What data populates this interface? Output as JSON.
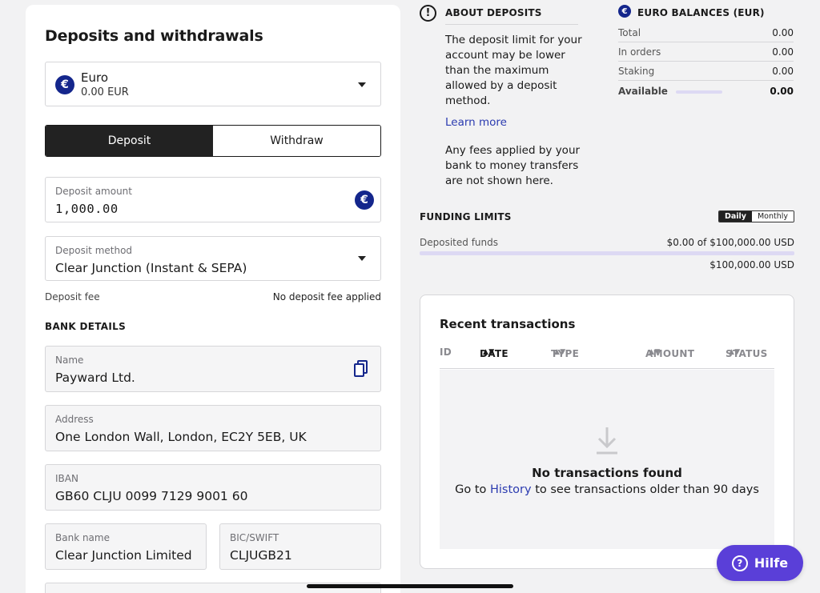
{
  "deposits": {
    "title": "Deposits and withdrawals",
    "currency": {
      "symbol": "€",
      "name": "Euro",
      "balance": "0.00 EUR"
    },
    "tabs": {
      "deposit": "Deposit",
      "withdraw": "Withdraw"
    },
    "amount": {
      "label": "Deposit amount",
      "value": "1,000.00",
      "symbol": "€"
    },
    "method": {
      "label": "Deposit method",
      "value": "Clear Junction (Instant & SEPA)"
    },
    "fee": {
      "label": "Deposit fee",
      "value": "No deposit fee applied"
    },
    "bank_details": {
      "heading": "BANK DETAILS",
      "name": {
        "label": "Name",
        "value": "Payward Ltd."
      },
      "address": {
        "label": "Address",
        "value": "One London Wall, London, EC2Y 5EB, UK"
      },
      "iban": {
        "label": "IBAN",
        "value": "GB60 CLJU 0099 7129 9001 60"
      },
      "bank_name": {
        "label": "Bank name",
        "value": "Clear Junction Limited"
      },
      "bic": {
        "label": "BIC/SWIFT",
        "value": "CLJUGB21"
      }
    }
  },
  "about": {
    "icon": "!",
    "title": "ABOUT DEPOSITS",
    "paragraph1": "The deposit limit for your account may be lower than the maximum allowed by a deposit method.",
    "learn_more": "Learn more",
    "paragraph2": "Any fees applied by your bank to money transfers are not shown here."
  },
  "balances": {
    "symbol": "€",
    "title": "EURO BALANCES (EUR)",
    "rows": [
      {
        "label": "Total",
        "value": "0.00"
      },
      {
        "label": "In orders",
        "value": "0.00"
      },
      {
        "label": "Staking",
        "value": "0.00"
      },
      {
        "label": "Available",
        "value": "0.00"
      }
    ]
  },
  "funding": {
    "title": "FUNDING LIMITS",
    "toggle": {
      "daily": "Daily",
      "monthly": "Monthly"
    },
    "deposited_label": "Deposited funds",
    "deposited_value": "$0.00 of $100,000.00 USD",
    "remaining": "$100,000.00 USD",
    "used_fraction": 0
  },
  "recent": {
    "title": "Recent transactions",
    "columns": {
      "id": "ID",
      "date": "DATE",
      "type": "TYPE",
      "amount": "AMOUNT",
      "status": "STATUS"
    },
    "sort_glyph": "▲▼",
    "empty_title": "No transactions found",
    "empty_pre": "Go to",
    "empty_link": "History",
    "empty_post": "to see transactions older than 90 days"
  },
  "help": {
    "label": "Hilfe",
    "icon": "?"
  },
  "colors": {
    "accent": "#5a3fd8",
    "euro_badge": "#14268c",
    "link": "#2b3bb0",
    "bar": "#ddd9f3"
  }
}
